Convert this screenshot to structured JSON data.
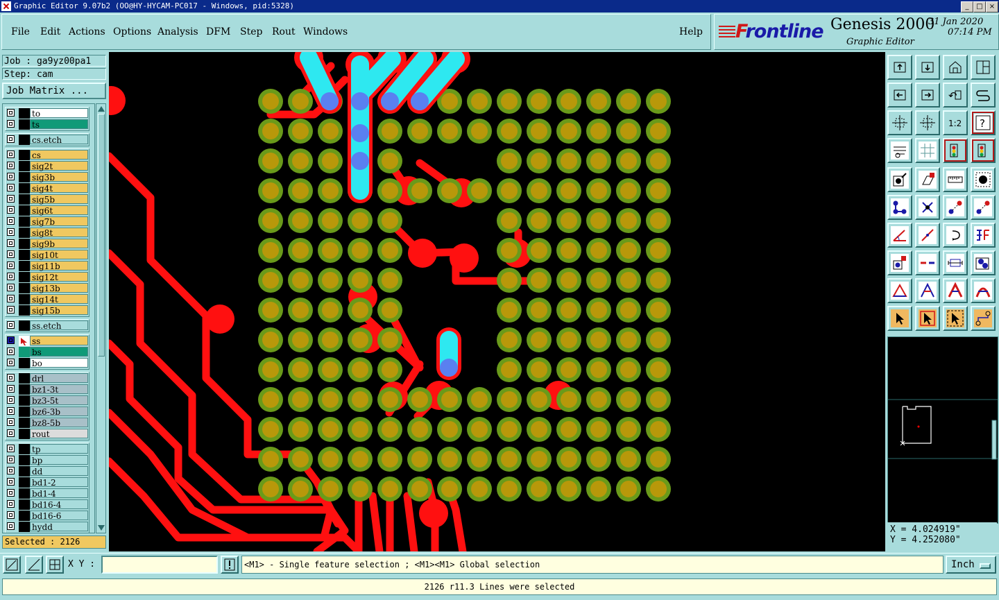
{
  "window": {
    "title": "Graphic Editor 9.07b2 (OO@HY-HYCAM-PC017 - Windows, pid:5328)",
    "buttons": [
      "_",
      "□",
      "×"
    ]
  },
  "menu": {
    "items": [
      "File",
      "Edit",
      "Actions",
      "Options",
      "Analysis",
      "DFM",
      "Step",
      "Rout",
      "Windows"
    ],
    "help": "Help"
  },
  "brand": {
    "logo_f": "F",
    "logo_rest": "rontline",
    "product": "Genesis 2000",
    "subtitle": "Graphic Editor",
    "date": "31 Jan 2020",
    "time": "07:14 PM"
  },
  "left": {
    "job": "Job : ga9yz00pa1",
    "step": "Step: cam",
    "job_matrix": "Job Matrix ...",
    "selected": "Selected : 2126",
    "layers": [
      {
        "name": "to",
        "color": "#ffffff",
        "group": 0
      },
      {
        "name": "ts",
        "color": "#109a78",
        "group": 0
      },
      {
        "name": "cs.etch",
        "color": "#a8dcdc",
        "group": 1
      },
      {
        "name": "cs",
        "color": "#f0c860",
        "group": 2
      },
      {
        "name": "sig2t",
        "color": "#f0c860",
        "group": 2
      },
      {
        "name": "sig3b",
        "color": "#f0c860",
        "group": 2
      },
      {
        "name": "sig4t",
        "color": "#f0c860",
        "group": 2
      },
      {
        "name": "sig5b",
        "color": "#f0c860",
        "group": 2
      },
      {
        "name": "sig6t",
        "color": "#f0c860",
        "group": 2
      },
      {
        "name": "sig7b",
        "color": "#f0c860",
        "group": 2
      },
      {
        "name": "sig8t",
        "color": "#f0c860",
        "group": 2
      },
      {
        "name": "sig9b",
        "color": "#f0c860",
        "group": 2
      },
      {
        "name": "sig10t",
        "color": "#f0c860",
        "group": 2
      },
      {
        "name": "sig11b",
        "color": "#f0c860",
        "group": 2
      },
      {
        "name": "sig12t",
        "color": "#f0c860",
        "group": 2
      },
      {
        "name": "sig13b",
        "color": "#f0c860",
        "group": 2
      },
      {
        "name": "sig14t",
        "color": "#f0c860",
        "group": 2
      },
      {
        "name": "sig15b",
        "color": "#f0c860",
        "group": 2
      },
      {
        "name": "ss.etch",
        "color": "#a8dcdc",
        "group": 3
      },
      {
        "name": "ss",
        "color": "#f0c860",
        "group": 4
      },
      {
        "name": "bs",
        "color": "#109a78",
        "group": 4
      },
      {
        "name": "bo",
        "color": "#ffffff",
        "group": 4
      },
      {
        "name": "drl",
        "color": "#a8c0c8",
        "group": 5
      },
      {
        "name": "bz1-3t",
        "color": "#a8c0c8",
        "group": 5
      },
      {
        "name": "bz3-5t",
        "color": "#a8c0c8",
        "group": 5
      },
      {
        "name": "bz6-3b",
        "color": "#a8c0c8",
        "group": 5
      },
      {
        "name": "bz8-5b",
        "color": "#a8c0c8",
        "group": 5
      },
      {
        "name": "rout",
        "color": "#dcdcdc",
        "group": 5
      },
      {
        "name": "tp",
        "color": "#a8dcdc",
        "group": 6
      },
      {
        "name": "bp",
        "color": "#a8dcdc",
        "group": 6
      },
      {
        "name": "dd",
        "color": "#a8dcdc",
        "group": 6
      },
      {
        "name": "bd1-2",
        "color": "#a8dcdc",
        "group": 6
      },
      {
        "name": "bd1-4",
        "color": "#a8dcdc",
        "group": 6
      },
      {
        "name": "bd16-4",
        "color": "#a8dcdc",
        "group": 6
      },
      {
        "name": "bd16-6",
        "color": "#a8dcdc",
        "group": 6
      },
      {
        "name": "hydd",
        "color": "#a8dcdc",
        "group": 6
      }
    ]
  },
  "right": {
    "x": "X = 4.024919\"",
    "y": "Y = 4.252080\"",
    "tools": [
      "up-icon",
      "down-icon",
      "home-icon",
      "window-icon",
      "left-icon",
      "right-icon",
      "zoom-back-icon",
      "sync-icon",
      "fit-icon",
      "zoom-center-icon",
      "one-to-two-icon",
      "help-icon",
      "properties-icon",
      "grid-icon",
      "traffic-icon",
      "traffic-edit-icon",
      "add-pad-icon",
      "add-shape-icon",
      "ruler-icon",
      "pad-icon",
      "connect-icon",
      "delete-icon",
      "move-icon",
      "copy-icon",
      "line-angle-icon",
      "line-icon",
      "arc-icon",
      "text-icon",
      "resize-icon",
      "split-icon",
      "measure-icon",
      "fill-icon",
      "triangle-icon",
      "flash-icon",
      "surface-icon",
      "arc-surface-icon",
      "select-icon",
      "select-box-icon",
      "select-poly-icon",
      "select-net-icon"
    ],
    "one_to_two": "1:2"
  },
  "bottom": {
    "xy_label": "X Y :",
    "xy_value": "",
    "hint": "<M1> - Single feature selection ; <M1><M1> Global selection",
    "units": "Inch",
    "status": "2126 r11.3 Lines were selected"
  },
  "colors": {
    "pad_outer": "#6a9a1a",
    "pad_inner": "#b8980a",
    "trace": "#ff1010",
    "selected": "#2ee8f0",
    "via": "#5a80f0",
    "background": "#000000"
  }
}
